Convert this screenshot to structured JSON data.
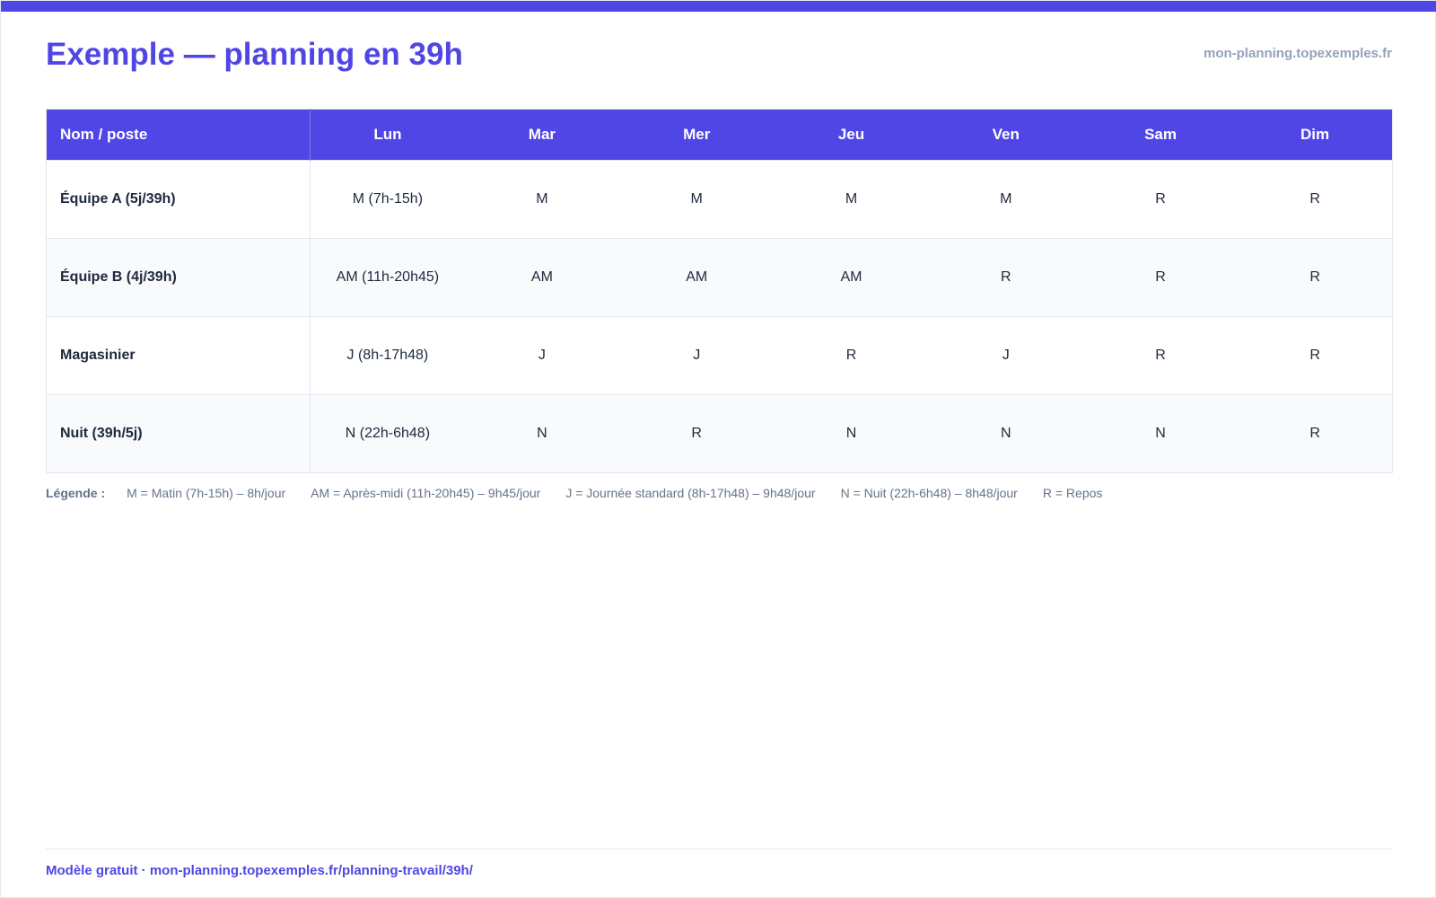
{
  "header": {
    "title": "Exemple — planning en 39h",
    "domain": "mon-planning.topexemples.fr"
  },
  "table": {
    "columns": [
      "Nom / poste",
      "Lun",
      "Mar",
      "Mer",
      "Jeu",
      "Ven",
      "Sam",
      "Dim"
    ],
    "rows": [
      {
        "name": "Équipe A (5j/39h)",
        "cells": [
          "M (7h-15h)",
          "M",
          "M",
          "M",
          "M",
          "R",
          "R"
        ]
      },
      {
        "name": "Équipe B (4j/39h)",
        "cells": [
          "AM (11h-20h45)",
          "AM",
          "AM",
          "AM",
          "R",
          "R",
          "R"
        ]
      },
      {
        "name": "Magasinier",
        "cells": [
          "J (8h-17h48)",
          "J",
          "J",
          "R",
          "J",
          "R",
          "R"
        ]
      },
      {
        "name": "Nuit (39h/5j)",
        "cells": [
          "N (22h-6h48)",
          "N",
          "R",
          "N",
          "N",
          "N",
          "R"
        ]
      }
    ]
  },
  "legend": {
    "title": "Légende :",
    "items": [
      "M = Matin (7h-15h) – 8h/jour",
      "AM = Après-midi (11h-20h45) – 9h45/jour",
      "J = Journée standard (8h-17h48) – 9h48/jour",
      "N = Nuit (22h-6h48) – 8h48/jour",
      "R = Repos"
    ]
  },
  "footer": {
    "text": "Modèle gratuit · mon-planning.topexemples.fr/planning-travail/39h/"
  },
  "colors": {
    "accent": "#4f46e5",
    "muted": "#94a3b8",
    "row_alt": "#f8fafc"
  }
}
